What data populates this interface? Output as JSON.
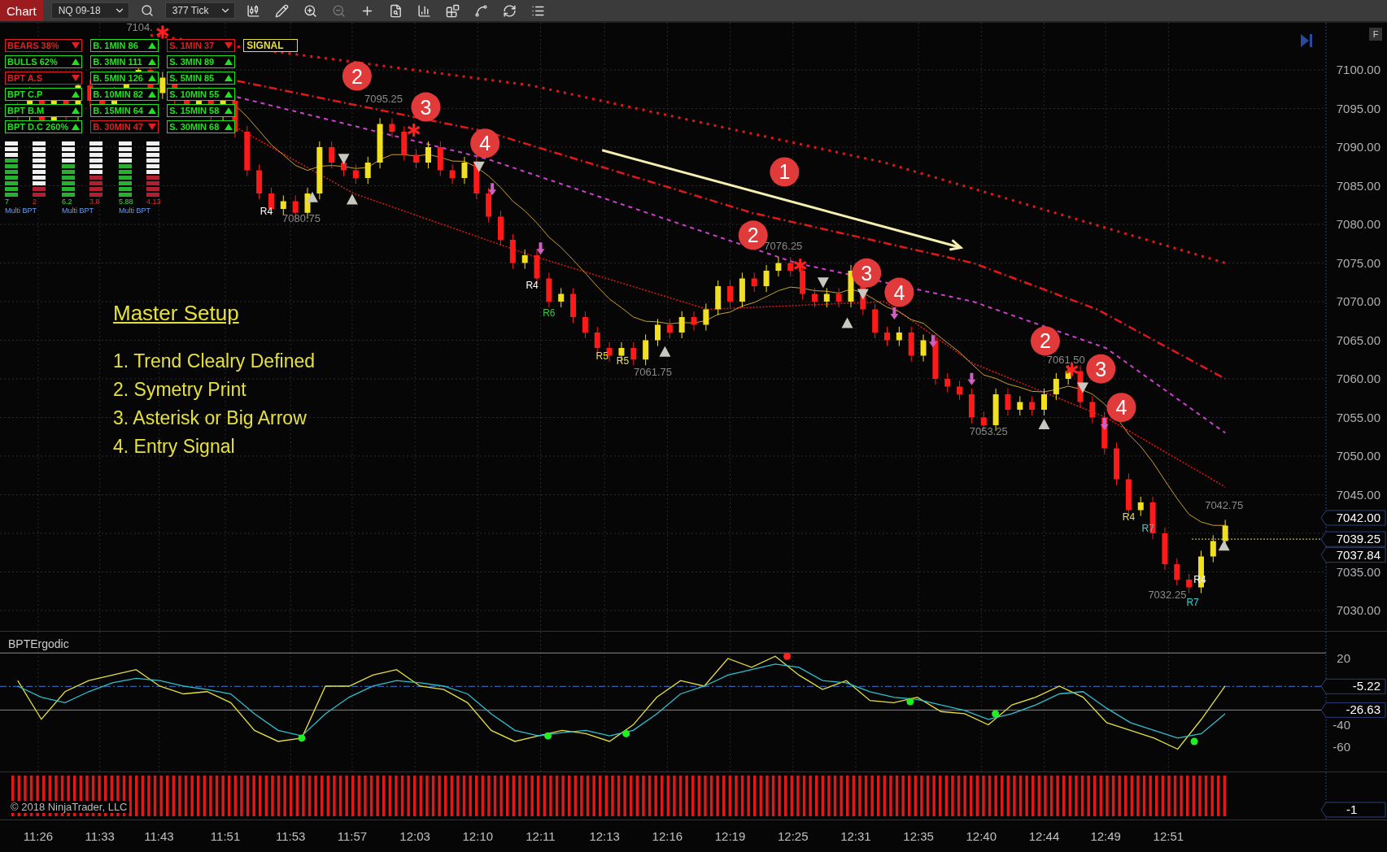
{
  "toolbar": {
    "chart_button": "Chart",
    "instrument": "NQ 09-18",
    "interval": "377 Tick"
  },
  "signal_panel": {
    "columns": [
      [
        {
          "label": "BEARS 38%",
          "bearish": true
        },
        {
          "label": "BULLS 62%",
          "bearish": false
        },
        {
          "label": "BPT A.S",
          "bearish": true
        },
        {
          "label": "BPT C.P",
          "bearish": false
        },
        {
          "label": "BPT B.M",
          "bearish": false
        },
        {
          "label": "BPT D.C 260%",
          "bearish": false
        }
      ],
      [
        {
          "label": "B. 1MIN 86",
          "bearish": false
        },
        {
          "label": "B. 3MIN 111",
          "bearish": false
        },
        {
          "label": "B. 5MIN 126",
          "bearish": false
        },
        {
          "label": "B. 10MIN 82",
          "bearish": false
        },
        {
          "label": "B. 15MIN 64",
          "bearish": false
        },
        {
          "label": "B. 30MIN 47",
          "bearish": true
        }
      ],
      [
        {
          "label": "S. 1MIN 37",
          "bearish": true
        },
        {
          "label": "S. 3MIN 89",
          "bearish": false
        },
        {
          "label": "S. 5MIN 85",
          "bearish": false
        },
        {
          "label": "S. 10MIN 55",
          "bearish": false
        },
        {
          "label": "S. 15MIN 58",
          "bearish": false
        },
        {
          "label": "S. 30MIN 68",
          "bearish": false
        }
      ]
    ],
    "signal_label": "SIGNAL",
    "meters": [
      {
        "reading": "7",
        "level": 0.7,
        "bearish": false
      },
      {
        "reading": "2",
        "level": 0.2,
        "bearish": true
      },
      {
        "reading": "6.2",
        "level": 0.62,
        "bearish": false
      },
      {
        "reading": "3.8",
        "level": 0.38,
        "bearish": true
      },
      {
        "reading": "5.88",
        "level": 0.59,
        "bearish": false
      },
      {
        "reading": "4.13",
        "level": 0.41,
        "bearish": true
      }
    ],
    "meter_captions": [
      "Multi BPT",
      "Multi BPT",
      "Multi BPT"
    ]
  },
  "setup_note": {
    "title": "Master Setup",
    "steps": [
      "1. Trend Clealry Defined",
      "2. Symetry Print",
      "3. Asterisk or Big Arrow",
      "4. Entry Signal"
    ]
  },
  "price_panel": {
    "scale_button": "F",
    "axis_labels": [
      "7100.00",
      "7095.00",
      "7090.00",
      "7085.00",
      "7080.00",
      "7075.00",
      "7070.00",
      "7065.00",
      "7060.00",
      "7055.00",
      "7050.00",
      "7045.00",
      "7035.00",
      "7030.00"
    ],
    "step_markers": [
      "1",
      "2",
      "3",
      "4",
      "2",
      "3",
      "4",
      "2",
      "3",
      "4"
    ],
    "price_labels": [
      "7104.",
      "7095.25",
      "7080.75",
      "7076.25",
      "7061.75",
      "7053.25",
      "7061.50",
      "7042.75",
      "7032.25"
    ],
    "level_labels": [
      {
        "text": "R4",
        "color": "#ffffff"
      },
      {
        "text": "R4",
        "color": "#ffffff"
      },
      {
        "text": "R6",
        "color": "#3cc83c"
      },
      {
        "text": "R5",
        "color": "#e6e03c"
      },
      {
        "text": "R5",
        "color": "#e6e03c"
      },
      {
        "text": "R4",
        "color": "#e6e03c"
      },
      {
        "text": "R7",
        "color": "#40d0d0"
      },
      {
        "text": "R4",
        "color": "#ffffff"
      },
      {
        "text": "R7",
        "color": "#40d0d0"
      }
    ],
    "price_tags": [
      "7042.00",
      "7039.25",
      "7037.84"
    ]
  },
  "indicator_panel": {
    "title": "BPTErgodic",
    "axis_labels": [
      "20",
      "-40",
      "-60"
    ],
    "value_tags": [
      "-5.22",
      "-26.63"
    ],
    "signal_dots": [
      {
        "color": "#22ee22"
      },
      {
        "color": "#22ee22"
      },
      {
        "color": "#22ee22"
      },
      {
        "color": "#ff2020"
      },
      {
        "color": "#22ee22"
      },
      {
        "color": "#22ee22"
      },
      {
        "color": "#22ee22"
      }
    ]
  },
  "histogram_panel": {
    "copyright": "© 2018 NinjaTrader, LLC",
    "tag": "-1"
  },
  "time_axis": [
    "11:26",
    "11:33",
    "11:43",
    "11:51",
    "11:53",
    "11:57",
    "12:03",
    "12:10",
    "12:11",
    "12:13",
    "12:16",
    "12:19",
    "12:25",
    "12:31",
    "12:35",
    "12:40",
    "12:44",
    "12:49",
    "12:51"
  ]
}
